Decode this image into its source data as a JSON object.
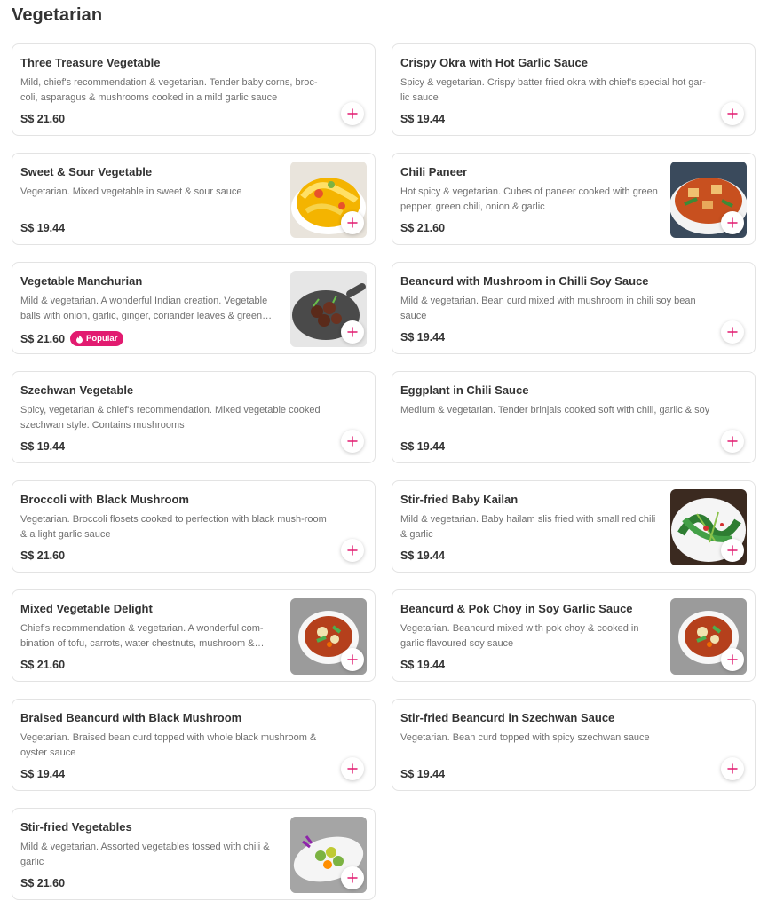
{
  "section": {
    "title": "Vegetarian"
  },
  "colors": {
    "brand_pink": "#e21b70",
    "text": "#333333",
    "muted": "#707070",
    "border": "#e3e3e3"
  },
  "items": [
    {
      "name": "Three Treasure Vegetable",
      "desc": "Mild, chief's recommendation & vegetarian. Tender baby corns, broc-coli, asparagus & mushrooms cooked in a mild garlic sauce",
      "price": "S$ 21.60",
      "image": ""
    },
    {
      "name": "Crispy Okra with Hot Garlic Sauce",
      "desc": "Spicy & vegetarian. Crispy batter fried okra with chief's special hot gar-lic sauce",
      "price": "S$ 19.44",
      "image": ""
    },
    {
      "name": "Sweet & Sour Vegetable",
      "desc": "Vegetarian. Mixed vegetable in sweet & sour sauce",
      "price": "S$ 19.44",
      "image": "sweet-sour"
    },
    {
      "name": "Chili Paneer",
      "desc": "Hot spicy & vegetarian. Cubes of paneer cooked with green pepper, green chili, onion & garlic",
      "price": "S$ 21.60",
      "image": "paneer"
    },
    {
      "name": "Vegetable Manchurian",
      "desc": "Mild & vegetarian. A wonderful Indian creation. Vegetable balls with onion, garlic, ginger, coriander leaves & green…",
      "price": "S$ 21.60",
      "image": "manchurian",
      "badge": "Popular"
    },
    {
      "name": "Beancurd with Mushroom in Chilli Soy Sauce",
      "desc": "Mild & vegetarian. Bean curd mixed with mushroom in chili soy bean sauce",
      "price": "S$ 19.44",
      "image": ""
    },
    {
      "name": "Szechwan Vegetable",
      "desc": "Spicy, vegetarian & chief's recommendation. Mixed vegetable cooked szechwan style. Contains mushrooms",
      "price": "S$ 19.44",
      "image": ""
    },
    {
      "name": "Eggplant in Chili Sauce",
      "desc": "Medium & vegetarian. Tender brinjals cooked soft with chili, garlic & soy",
      "price": "S$ 19.44",
      "image": ""
    },
    {
      "name": "Broccoli with Black Mushroom",
      "desc": "Vegetarian. Broccoli flosets cooked to perfection with black mush-room & a light garlic sauce",
      "price": "S$ 21.60",
      "image": ""
    },
    {
      "name": "Stir-fried Baby Kailan",
      "desc": "Mild & vegetarian. Baby hailam slis fried with small red chili & garlic",
      "price": "S$ 19.44",
      "image": "kailan"
    },
    {
      "name": "Mixed Vegetable Delight",
      "desc": "Chief's recommendation & vegetarian. A wonderful com-bination of tofu, carrots, water chestnuts, mushroom &…",
      "price": "S$ 21.60",
      "image": "bowl"
    },
    {
      "name": "Beancurd & Pok Choy in Soy Garlic Sauce",
      "desc": "Vegetarian. Beancurd mixed with pok choy & cooked in garlic flavoured soy sauce",
      "price": "S$ 19.44",
      "image": "bowl"
    },
    {
      "name": "Braised Beancurd with Black Mushroom",
      "desc": "Vegetarian. Braised bean curd topped with whole black mushroom & oyster sauce",
      "price": "S$ 19.44",
      "image": ""
    },
    {
      "name": "Stir-fried Beancurd in Szechwan Sauce",
      "desc": "Vegetarian. Bean curd topped with spicy szechwan sauce",
      "price": "S$ 19.44",
      "image": ""
    },
    {
      "name": "Stir-fried Vegetables",
      "desc": "Mild & vegetarian. Assorted vegetables tossed with chili & garlic",
      "price": "S$ 21.60",
      "image": "plate"
    }
  ]
}
